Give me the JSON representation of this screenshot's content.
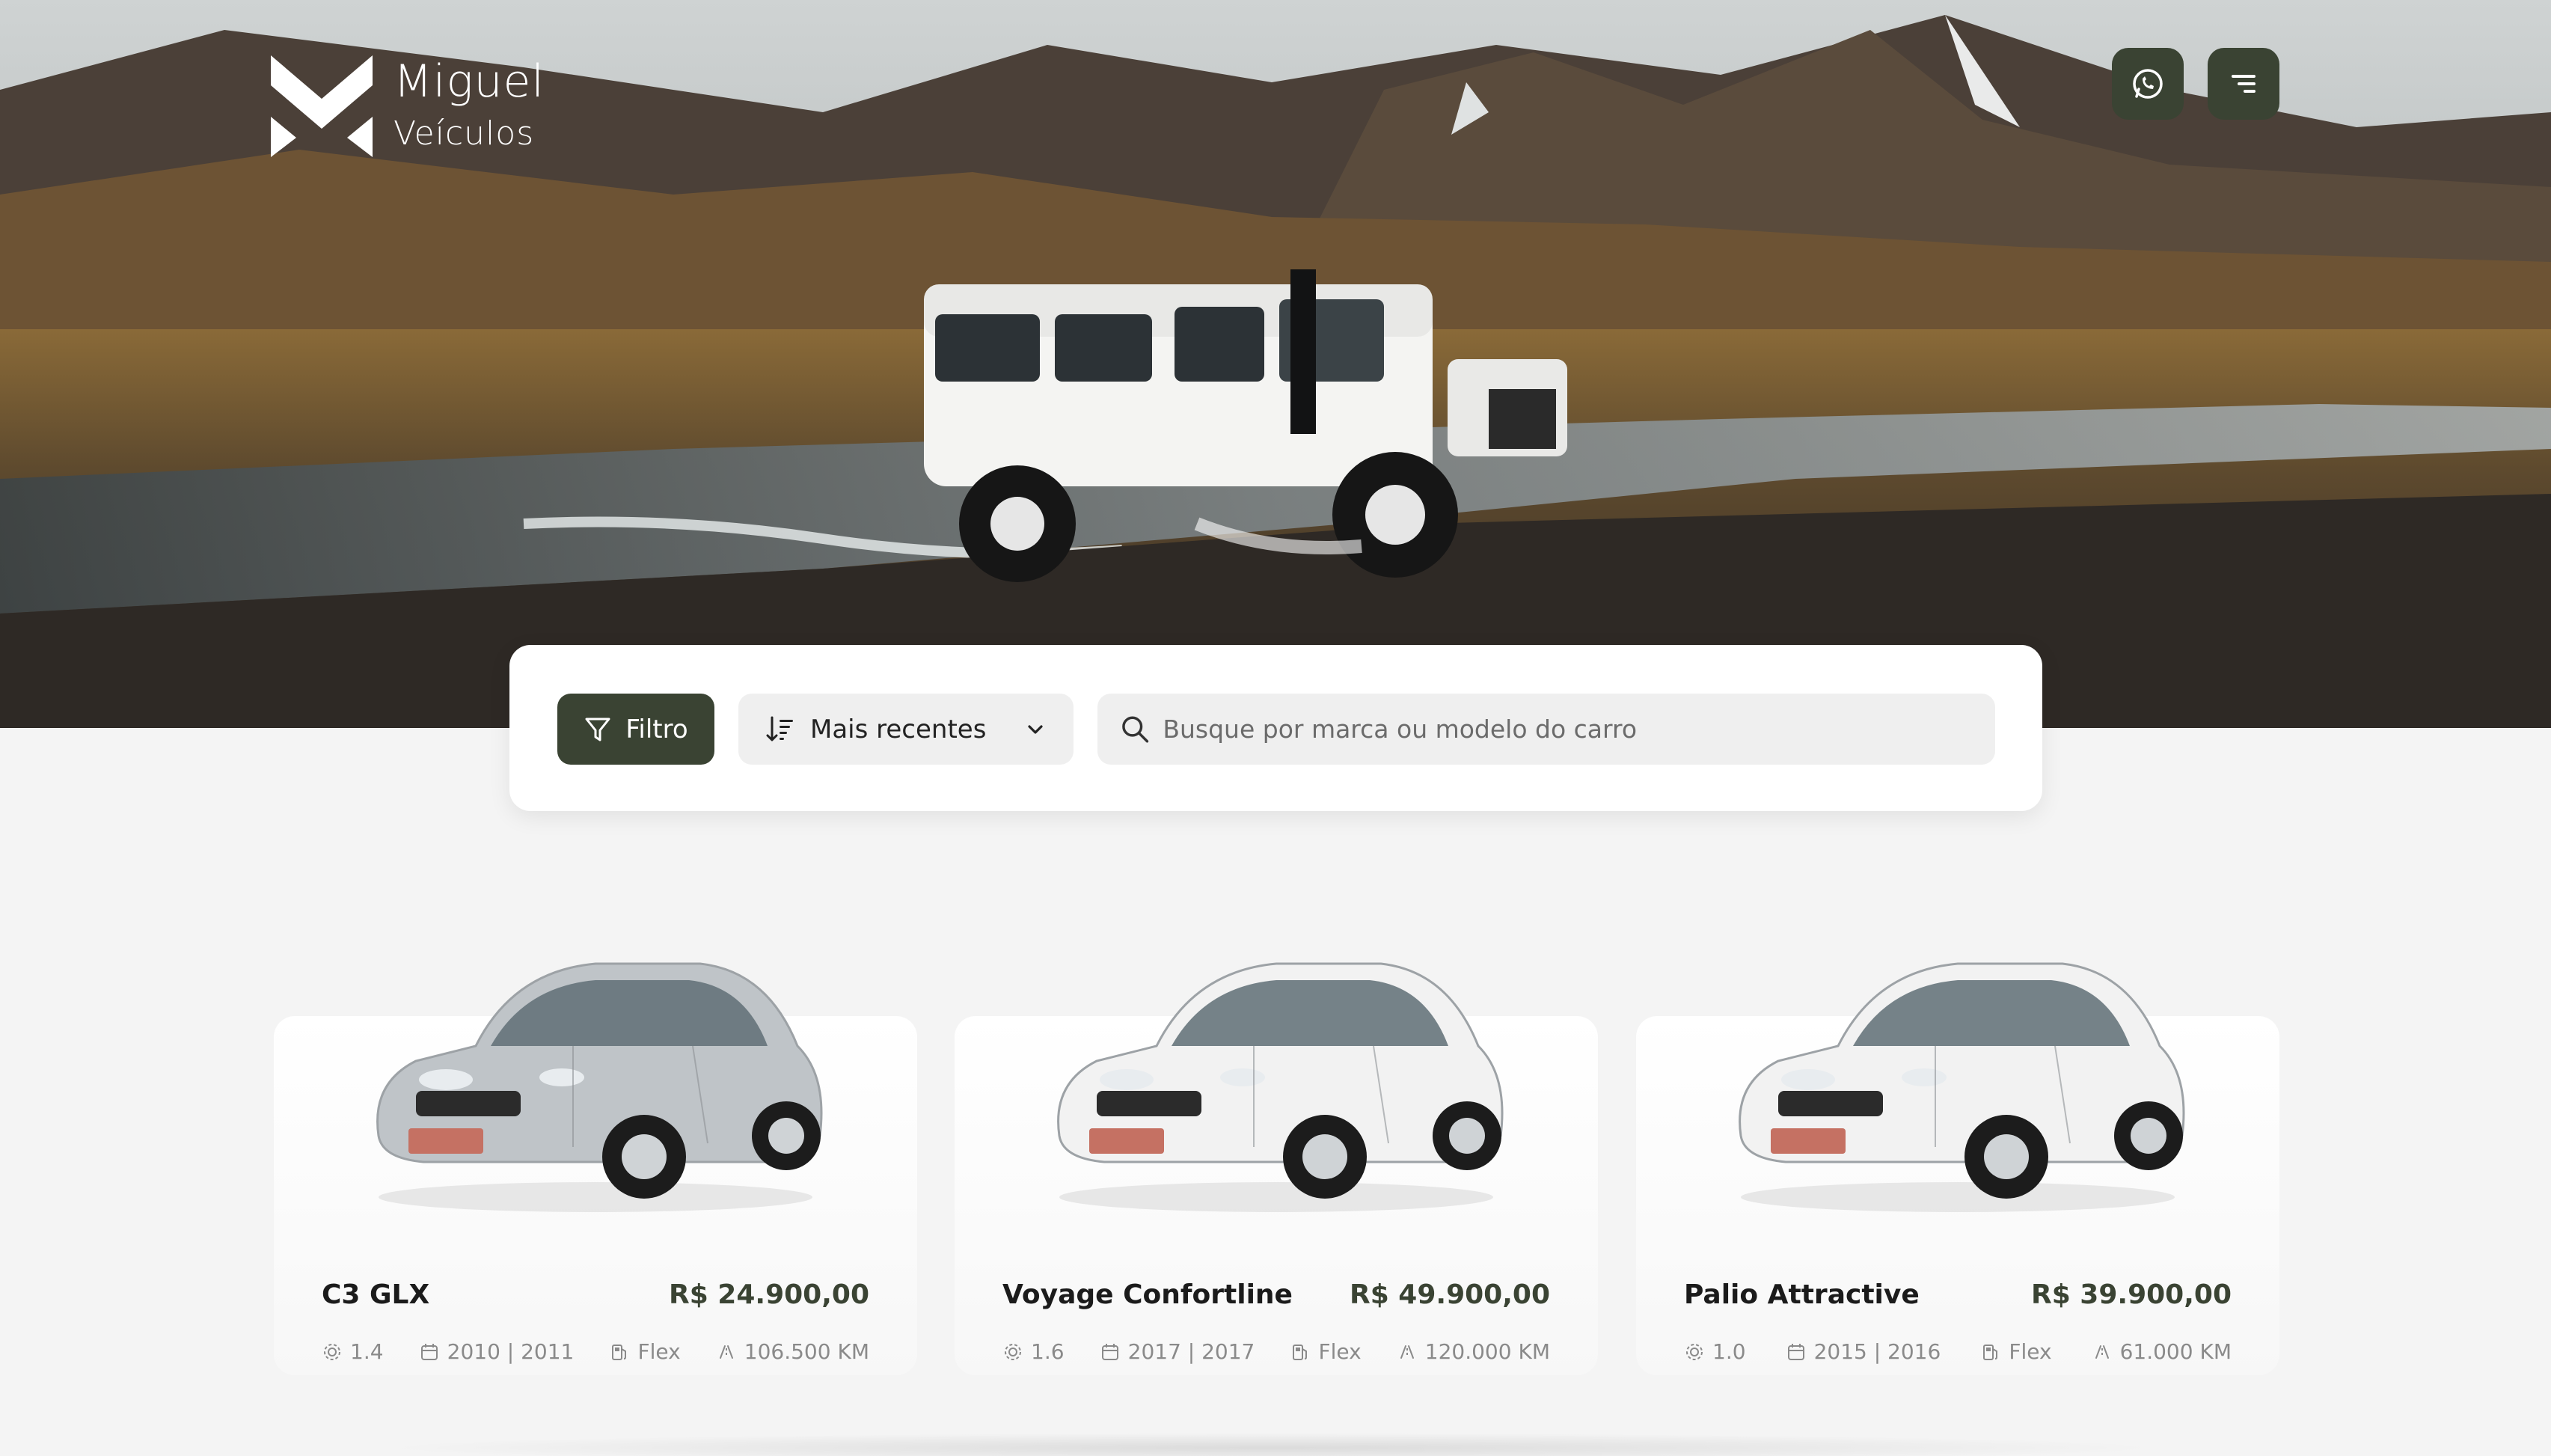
{
  "brand": {
    "line1": "Miguel",
    "line2": "Veículos"
  },
  "header": {
    "whatsapp_icon": "whatsapp-icon",
    "menu_icon": "menu-icon",
    "accent_color": "#3a4333"
  },
  "toolbar": {
    "filter_label": "Filtro",
    "sort_selected": "Mais recentes",
    "search_placeholder": "Busque por marca ou modelo do carro"
  },
  "cars": [
    {
      "name": "C3 GLX",
      "price": "R$ 24.900,00",
      "engine": "1.4",
      "year": "2010 | 2011",
      "fuel": "Flex",
      "mileage": "106.500 KM",
      "color": "#bfc4c8"
    },
    {
      "name": "Voyage Confortline",
      "price": "R$ 49.900,00",
      "engine": "1.6",
      "year": "2017 | 2017",
      "fuel": "Flex",
      "mileage": "120.000 KM",
      "color": "#f2f2f2"
    },
    {
      "name": "Palio Attractive",
      "price": "R$ 39.900,00",
      "engine": "1.0",
      "year": "2015 | 2016",
      "fuel": "Flex",
      "mileage": "61.000 KM",
      "color": "#f2f2f2"
    }
  ]
}
